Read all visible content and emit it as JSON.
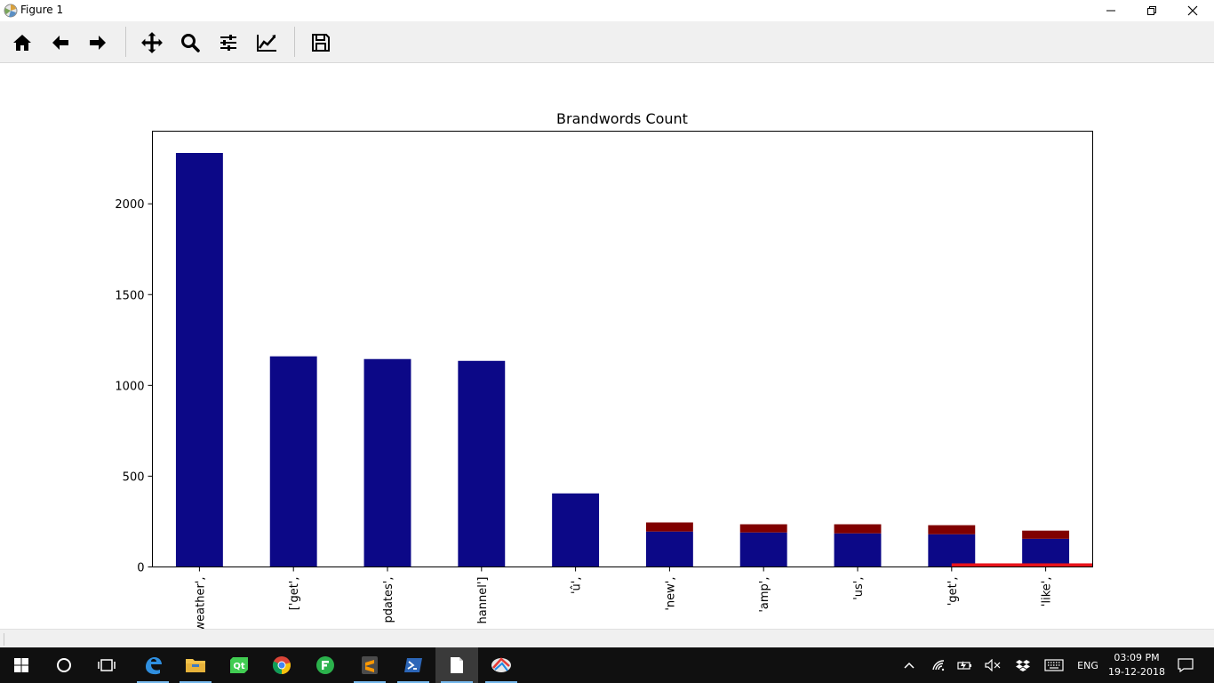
{
  "window": {
    "title": "Figure 1"
  },
  "toolbar": {
    "buttons": [
      {
        "name": "home",
        "icon": "home-icon"
      },
      {
        "name": "back",
        "icon": "arrow-left-icon"
      },
      {
        "name": "forward",
        "icon": "arrow-right-icon"
      },
      {
        "name": "pan",
        "icon": "move-icon"
      },
      {
        "name": "zoom",
        "icon": "magnifier-icon"
      },
      {
        "name": "subplots",
        "icon": "sliders-icon"
      },
      {
        "name": "edit-axes",
        "icon": "line-chart-icon"
      },
      {
        "name": "save",
        "icon": "floppy-disk-icon"
      }
    ]
  },
  "chart_data": {
    "type": "bar",
    "title": "Brandwords Count",
    "xlabel": "",
    "ylabel": "",
    "categories": [
      "'weather',",
      "['get',",
      "'updates',",
      "'channel']",
      "'û',",
      "'new',",
      "'amp',",
      "'us',",
      "'get',",
      "'like',"
    ],
    "category_labels_visible": [
      "weather',",
      "['get',",
      "pdates',",
      "hannel']",
      "'û',",
      "'new',",
      "'amp',",
      "'us',",
      "'get',",
      "'like',"
    ],
    "series": [
      {
        "color": "#0c0887",
        "values": [
          2280,
          1160,
          1145,
          1135,
          405,
          195,
          190,
          185,
          180,
          155
        ]
      },
      {
        "color": "#800000",
        "values": [
          0,
          0,
          0,
          0,
          0,
          50,
          45,
          50,
          50,
          45
        ]
      }
    ],
    "overlay_line": {
      "color": "#e8141c",
      "y": 10
    },
    "ylim": [
      0,
      2400
    ],
    "yticks": [
      0,
      500,
      1000,
      1500,
      2000
    ],
    "grid": false
  },
  "taskbar": {
    "apps": [
      {
        "name": "start",
        "icon": "windows-icon"
      },
      {
        "name": "search",
        "icon": "cortana-circle-icon"
      },
      {
        "name": "task-view",
        "icon": "task-view-icon"
      },
      {
        "name": "edge",
        "icon": "edge-icon"
      },
      {
        "name": "file-explorer",
        "icon": "folder-icon"
      },
      {
        "name": "qt",
        "icon": "qt-icon"
      },
      {
        "name": "chrome",
        "icon": "chrome-icon"
      },
      {
        "name": "feedly",
        "icon": "feedly-icon"
      },
      {
        "name": "sublime",
        "icon": "sublime-icon"
      },
      {
        "name": "powershell",
        "icon": "powershell-icon"
      },
      {
        "name": "document",
        "icon": "document-icon"
      },
      {
        "name": "python-figure",
        "icon": "python-figure-icon"
      }
    ],
    "tray": {
      "language": "ENG",
      "time": "03:09 PM",
      "date": "19-12-2018"
    }
  }
}
